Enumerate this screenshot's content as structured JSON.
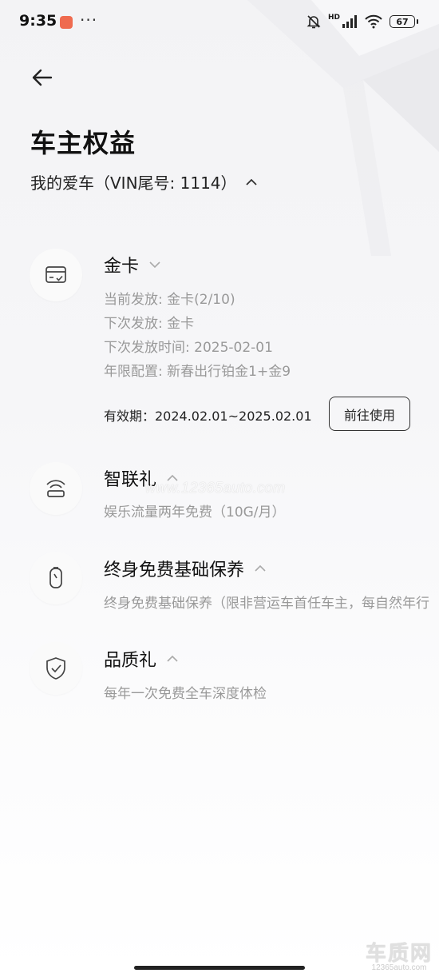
{
  "status_bar": {
    "time": "9:35",
    "more": "···",
    "network_badge": "HD",
    "battery": "67",
    "icons": [
      "mute-bell-icon",
      "signal-icon",
      "wifi-icon",
      "battery-icon"
    ]
  },
  "header": {
    "back_icon": "back-arrow-icon",
    "title": "车主权益",
    "car_selector": "我的爱车（VIN尾号: 1114）"
  },
  "benefits": [
    {
      "icon": "card-icon",
      "title": "金卡",
      "expanded": true,
      "details": [
        "当前发放: 金卡(2/10)",
        "下次发放: 金卡",
        "下次发放时间: 2025-02-01",
        "年限配置: 新春出行铂金1+金9"
      ],
      "validity": "有效期：2024.02.01~2025.02.01",
      "action_label": "前往使用"
    },
    {
      "icon": "connectivity-icon",
      "title": "智联礼",
      "details": [
        "娱乐流量两年免费（10G/月）"
      ]
    },
    {
      "icon": "maintenance-icon",
      "title": "终身免费基础保养",
      "details": [
        "终身免费基础保养（限非营运车首任车主，每自然年行"
      ]
    },
    {
      "icon": "shield-check-icon",
      "title": "品质礼",
      "details": [
        "每年一次免费全车深度体检"
      ]
    }
  ],
  "watermark": {
    "mid_text": "www.12365auto.com",
    "logo_text": "车质网",
    "logo_url": "12365auto.com"
  },
  "colors": {
    "text_primary": "#111111",
    "text_secondary": "#999999",
    "accent_status": "#ef6b4f"
  }
}
